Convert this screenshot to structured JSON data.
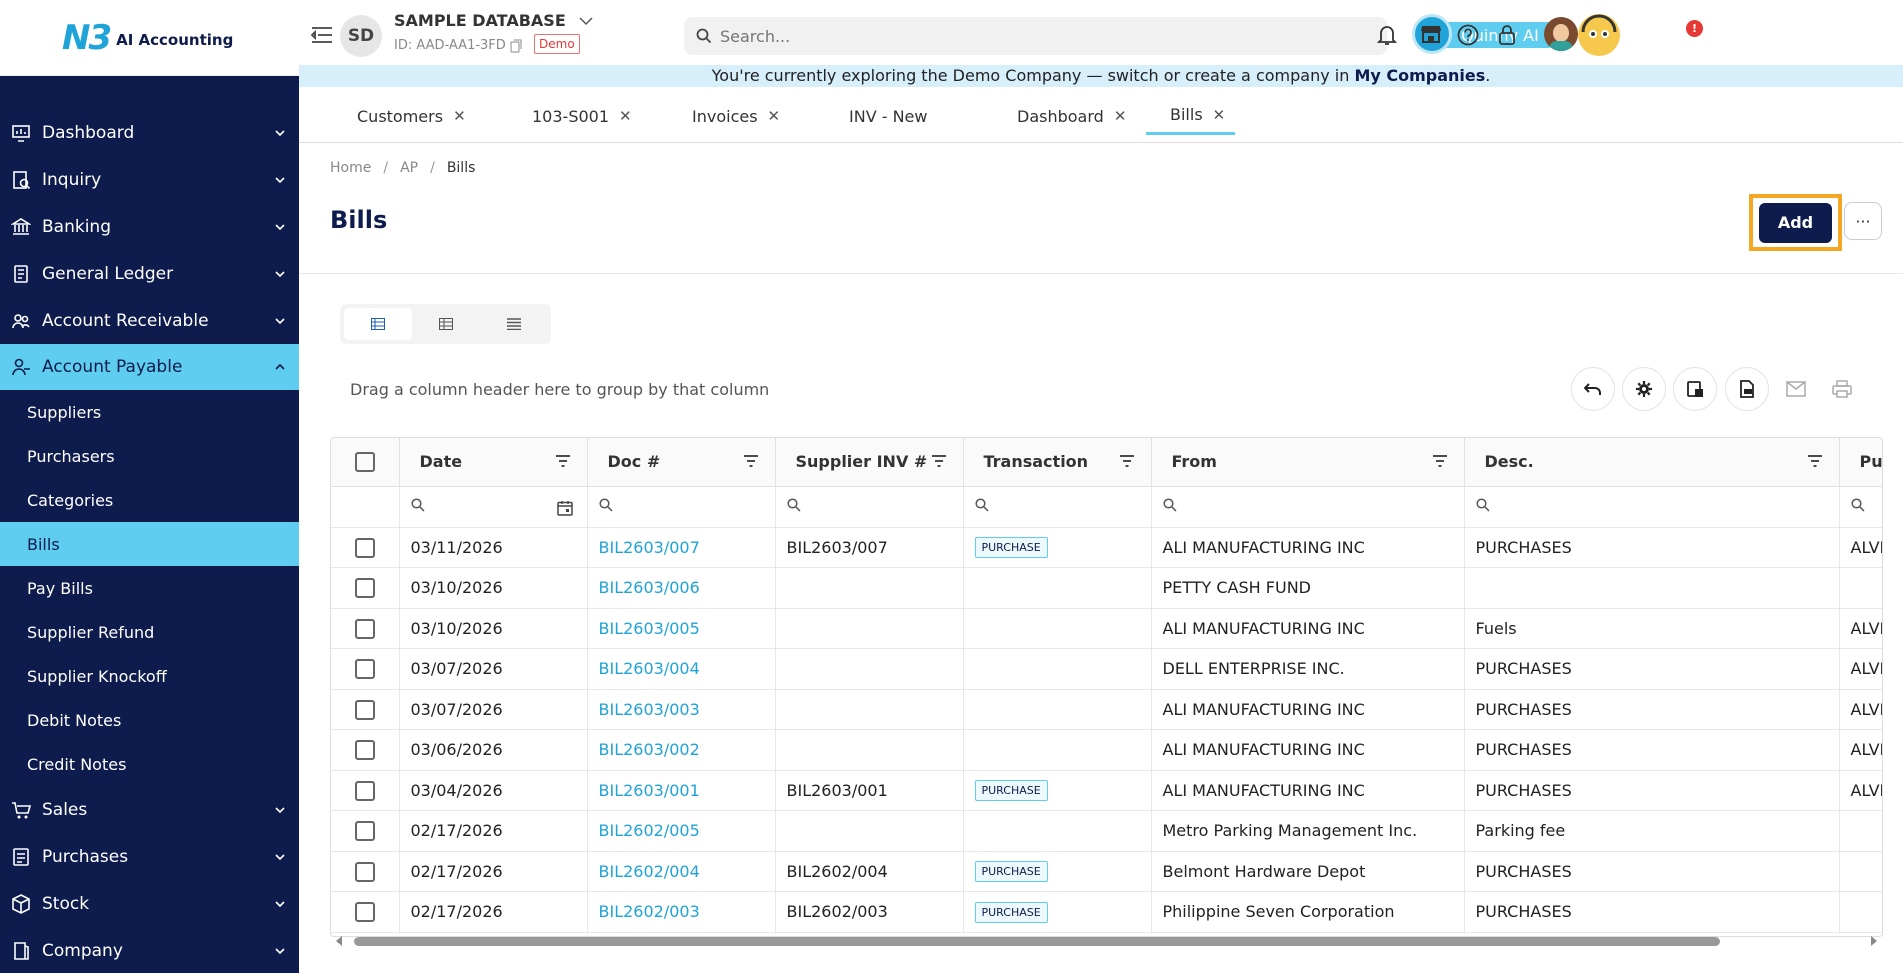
{
  "app": {
    "logo_mark": "N3",
    "logo_text": "AI Accounting"
  },
  "sidebar": {
    "items": [
      {
        "label": "Dashboard",
        "icon": "dashboard-icon"
      },
      {
        "label": "Inquiry",
        "icon": "inquiry-icon"
      },
      {
        "label": "Banking",
        "icon": "bank-icon"
      },
      {
        "label": "General Ledger",
        "icon": "ledger-icon"
      },
      {
        "label": "Account Receivable",
        "icon": "receivable-icon"
      },
      {
        "label": "Account Payable",
        "icon": "payable-icon"
      },
      {
        "label": "Sales",
        "icon": "sales-icon"
      },
      {
        "label": "Purchases",
        "icon": "purchases-icon"
      },
      {
        "label": "Stock",
        "icon": "stock-icon"
      },
      {
        "label": "Company",
        "icon": "company-icon"
      }
    ],
    "subitems": [
      "Suppliers",
      "Purchasers",
      "Categories",
      "Bills",
      "Pay Bills",
      "Supplier Refund",
      "Supplier Knockoff",
      "Debit Notes",
      "Credit Notes"
    ],
    "active_item": "Account Payable",
    "active_subitem": "Bills"
  },
  "header": {
    "avatar_initials": "SD",
    "db_name": "SAMPLE DATABASE",
    "db_id": "ID: AAD-AA1-3FD",
    "demo_label": "Demo",
    "search_placeholder": "Search...",
    "assistant_label": "Quinny AI",
    "notification_count": "!"
  },
  "banner": {
    "text": "You're currently exploring the Demo Company — switch or create a company in ",
    "link": "My Companies",
    "suffix": "."
  },
  "tabs": [
    {
      "label": "Customers",
      "closable": true
    },
    {
      "label": "103-S001",
      "closable": true
    },
    {
      "label": "Invoices",
      "closable": true
    },
    {
      "label": "INV - New",
      "closable": false
    },
    {
      "label": "Dashboard",
      "closable": true
    },
    {
      "label": "Bills",
      "closable": true,
      "active": true
    }
  ],
  "breadcrumb": [
    "Home",
    "AP",
    "Bills"
  ],
  "page": {
    "title": "Bills",
    "add_label": "Add",
    "more_label": "···"
  },
  "grid": {
    "group_hint": "Drag a column header here to group by that column",
    "columns": [
      "Date",
      "Doc #",
      "Supplier INV #",
      "Transaction",
      "From",
      "Desc.",
      "Pur"
    ],
    "rows": [
      {
        "date": "03/11/2026",
        "doc": "BIL2603/007",
        "supplier_inv": "BIL2603/007",
        "transaction": "PURCHASE",
        "from": "ALI MANUFACTURING INC",
        "desc": "PURCHASES",
        "pur": "ALVI"
      },
      {
        "date": "03/10/2026",
        "doc": "BIL2603/006",
        "supplier_inv": "",
        "transaction": "",
        "from": "PETTY CASH FUND",
        "desc": "",
        "pur": ""
      },
      {
        "date": "03/10/2026",
        "doc": "BIL2603/005",
        "supplier_inv": "",
        "transaction": "",
        "from": "ALI MANUFACTURING INC",
        "desc": "Fuels",
        "pur": "ALVI"
      },
      {
        "date": "03/07/2026",
        "doc": "BIL2603/004",
        "supplier_inv": "",
        "transaction": "",
        "from": "DELL ENTERPRISE INC.",
        "desc": "PURCHASES",
        "pur": "ALVI"
      },
      {
        "date": "03/07/2026",
        "doc": "BIL2603/003",
        "supplier_inv": "",
        "transaction": "",
        "from": "ALI MANUFACTURING INC",
        "desc": "PURCHASES",
        "pur": "ALVI"
      },
      {
        "date": "03/06/2026",
        "doc": "BIL2603/002",
        "supplier_inv": "",
        "transaction": "",
        "from": "ALI MANUFACTURING INC",
        "desc": "PURCHASES",
        "pur": "ALVI"
      },
      {
        "date": "03/04/2026",
        "doc": "BIL2603/001",
        "supplier_inv": "BIL2603/001",
        "transaction": "PURCHASE",
        "from": "ALI MANUFACTURING INC",
        "desc": "PURCHASES",
        "pur": "ALVI"
      },
      {
        "date": "02/17/2026",
        "doc": "BIL2602/005",
        "supplier_inv": "",
        "transaction": "",
        "from": "Metro Parking Management Inc.",
        "desc": "Parking fee",
        "pur": ""
      },
      {
        "date": "02/17/2026",
        "doc": "BIL2602/004",
        "supplier_inv": "BIL2602/004",
        "transaction": "PURCHASE",
        "from": "Belmont Hardware Depot",
        "desc": "PURCHASES",
        "pur": ""
      },
      {
        "date": "02/17/2026",
        "doc": "BIL2602/003",
        "supplier_inv": "BIL2602/003",
        "transaction": "PURCHASE",
        "from": "Philippine Seven Corporation",
        "desc": "PURCHASES",
        "pur": ""
      }
    ]
  },
  "colors": {
    "sidebar": "#0d1c4d",
    "accent": "#5fcdf0",
    "link": "#1fa3d8",
    "highlight": "#f5a623"
  }
}
